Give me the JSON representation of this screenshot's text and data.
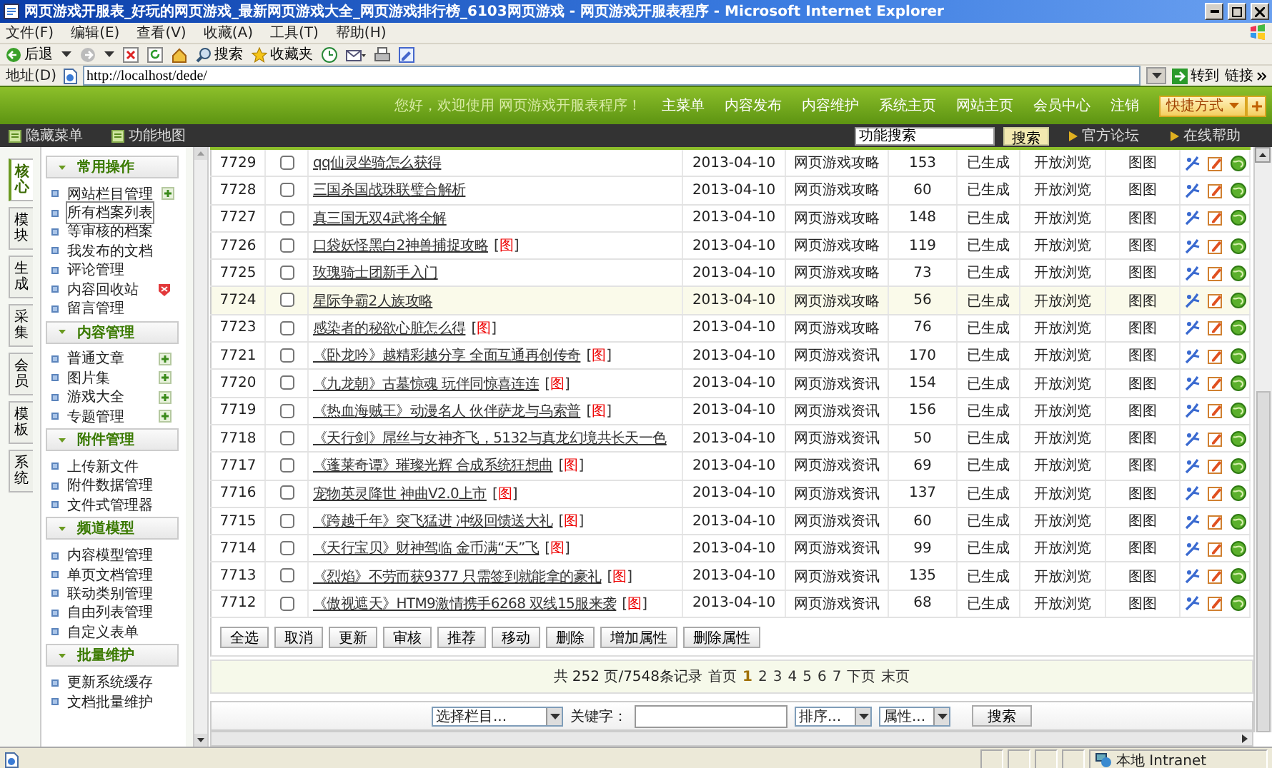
{
  "window": {
    "title": "网页游戏开服表_好玩的网页游戏_最新网页游戏大全_网页游戏排行榜_6103网页游戏 - 网页游戏开服表程序 - Microsoft Internet Explorer"
  },
  "menu_bar": [
    "文件(F)",
    "编辑(E)",
    "查看(V)",
    "收藏(A)",
    "工具(T)",
    "帮助(H)"
  ],
  "toolbar": {
    "back": "后退",
    "search": "搜索",
    "favorites": "收藏夹"
  },
  "address_bar": {
    "label": "地址(D)",
    "url": "http://localhost/dede/",
    "go": "转到",
    "links": "链接"
  },
  "header": {
    "welcome": "您好，欢迎使用 网页游戏开服表程序！",
    "nav": [
      "主菜单",
      "内容发布",
      "内容维护",
      "系统主页",
      "网站主页",
      "会员中心",
      "注销"
    ],
    "shortcut": "快捷方式"
  },
  "subbar": {
    "hide_menu": "隐藏菜单",
    "function_map": "功能地图",
    "search_value": "功能搜索",
    "search_button": "搜索",
    "links": [
      "官方论坛",
      "在线帮助"
    ]
  },
  "sidebar": {
    "tabs": [
      {
        "label": "核心",
        "selected": true
      },
      {
        "label": "模块",
        "selected": false
      },
      {
        "label": "生成",
        "selected": false
      },
      {
        "label": "采集",
        "selected": false
      },
      {
        "label": "会员",
        "selected": false
      },
      {
        "label": "模板",
        "selected": false
      },
      {
        "label": "系统",
        "selected": false
      }
    ],
    "groups": [
      {
        "title": "常用操作",
        "items": [
          {
            "label": "网站栏目管理",
            "kind": "add",
            "selected": false
          },
          {
            "label": "所有档案列表",
            "kind": "link",
            "selected": true
          },
          {
            "label": "等审核的档案",
            "kind": "link",
            "selected": false
          },
          {
            "label": "我发布的文档",
            "kind": "link",
            "selected": false
          },
          {
            "label": "评论管理",
            "kind": "link",
            "selected": false
          },
          {
            "label": "内容回收站",
            "kind": "delete",
            "selected": false
          },
          {
            "label": "留言管理",
            "kind": "link",
            "selected": false
          }
        ]
      },
      {
        "title": "内容管理",
        "items": [
          {
            "label": "普通文章",
            "kind": "add",
            "selected": false
          },
          {
            "label": "图片集",
            "kind": "add",
            "selected": false
          },
          {
            "label": "游戏大全",
            "kind": "add",
            "selected": false
          },
          {
            "label": "专题管理",
            "kind": "add",
            "selected": false
          }
        ]
      },
      {
        "title": "附件管理",
        "items": [
          {
            "label": "上传新文件",
            "kind": "link",
            "selected": false
          },
          {
            "label": "附件数据管理",
            "kind": "link",
            "selected": false
          },
          {
            "label": "文件式管理器",
            "kind": "link",
            "selected": false
          }
        ]
      },
      {
        "title": "频道模型",
        "items": [
          {
            "label": "内容模型管理",
            "kind": "link",
            "selected": false
          },
          {
            "label": "单页文档管理",
            "kind": "link",
            "selected": false
          },
          {
            "label": "联动类别管理",
            "kind": "link",
            "selected": false
          },
          {
            "label": "自由列表管理",
            "kind": "link",
            "selected": false
          },
          {
            "label": "自定义表单",
            "kind": "link",
            "selected": false
          }
        ]
      },
      {
        "title": "批量维护",
        "items": [
          {
            "label": "更新系统缓存",
            "kind": "link",
            "selected": false
          },
          {
            "label": "文档批量维护",
            "kind": "link",
            "selected": false
          }
        ]
      }
    ]
  },
  "table": {
    "rows": [
      {
        "id": "7729",
        "title": "qq仙灵坐骑怎么获得",
        "date": "2013-04-10",
        "category": "网页游戏攻略",
        "clicks": "153",
        "status": "已生成",
        "access": "开放浏览",
        "column_9": "图图",
        "checked": false,
        "highlighted": false
      },
      {
        "id": "7728",
        "title": "三国杀国战珠联璧合解析",
        "date": "2013-04-10",
        "category": "网页游戏攻略",
        "clicks": "60",
        "status": "已生成",
        "access": "开放浏览",
        "column_9": "图图",
        "checked": false,
        "highlighted": false
      },
      {
        "id": "7727",
        "title": "真三国无双4武将全解",
        "date": "2013-04-10",
        "category": "网页游戏攻略",
        "clicks": "148",
        "status": "已生成",
        "access": "开放浏览",
        "column_9": "图图",
        "checked": false,
        "highlighted": false
      },
      {
        "id": "7726",
        "title": "口袋妖怪黑白2神兽捕捉攻略",
        "tag": "[图]",
        "date": "2013-04-10",
        "category": "网页游戏攻略",
        "clicks": "119",
        "status": "已生成",
        "access": "开放浏览",
        "column_9": "图图",
        "checked": false,
        "highlighted": false
      },
      {
        "id": "7725",
        "title": "玫瑰骑士团新手入门",
        "date": "2013-04-10",
        "category": "网页游戏攻略",
        "clicks": "73",
        "status": "已生成",
        "access": "开放浏览",
        "column_9": "图图",
        "checked": false,
        "highlighted": false
      },
      {
        "id": "7724",
        "title": "星际争霸2人族攻略",
        "date": "2013-04-10",
        "category": "网页游戏攻略",
        "clicks": "56",
        "status": "已生成",
        "access": "开放浏览",
        "column_9": "图图",
        "checked": false,
        "highlighted": true
      },
      {
        "id": "7723",
        "title": "感染者的秘欲心脏怎么得",
        "tag": "[图]",
        "date": "2013-04-10",
        "category": "网页游戏攻略",
        "clicks": "76",
        "status": "已生成",
        "access": "开放浏览",
        "column_9": "图图",
        "checked": false,
        "highlighted": false
      },
      {
        "id": "7721",
        "title": "《卧龙吟》越精彩越分享 全面互通再创传奇",
        "tag": "[图]",
        "date": "2013-04-10",
        "category": "网页游戏资讯",
        "clicks": "170",
        "status": "已生成",
        "access": "开放浏览",
        "column_9": "图图",
        "checked": false,
        "highlighted": false
      },
      {
        "id": "7720",
        "title": "《九龙朝》古墓惊魂 玩伴同惊喜连连",
        "tag": "[图]",
        "date": "2013-04-10",
        "category": "网页游戏资讯",
        "clicks": "154",
        "status": "已生成",
        "access": "开放浏览",
        "column_9": "图图",
        "checked": false,
        "highlighted": false
      },
      {
        "id": "7719",
        "title": "《热血海贼王》动漫名人 伙伴萨龙与乌索普",
        "tag": "[图]",
        "date": "2013-04-10",
        "category": "网页游戏资讯",
        "clicks": "156",
        "status": "已生成",
        "access": "开放浏览",
        "column_9": "图图",
        "checked": false,
        "highlighted": false
      },
      {
        "id": "7718",
        "title": "《天行剑》屌丝与女神齐飞，5132与真龙幻境共长天一色",
        "date": "2013-04-10",
        "category": "网页游戏资讯",
        "clicks": "50",
        "status": "已生成",
        "access": "开放浏览",
        "column_9": "图图",
        "checked": false,
        "highlighted": false
      },
      {
        "id": "7717",
        "title": "《蓬莱奇谭》璀璨光辉 合成系统狂想曲",
        "tag": "[图]",
        "date": "2013-04-10",
        "category": "网页游戏资讯",
        "clicks": "69",
        "status": "已生成",
        "access": "开放浏览",
        "column_9": "图图",
        "checked": false,
        "highlighted": false
      },
      {
        "id": "7716",
        "title": "宠物英灵降世 神曲V2.0上市",
        "tag": "[图]",
        "date": "2013-04-10",
        "category": "网页游戏资讯",
        "clicks": "137",
        "status": "已生成",
        "access": "开放浏览",
        "column_9": "图图",
        "checked": false,
        "highlighted": false
      },
      {
        "id": "7715",
        "title": "《跨越千年》突飞猛进 冲级回馈送大礼",
        "tag": "[图]",
        "date": "2013-04-10",
        "category": "网页游戏资讯",
        "clicks": "60",
        "status": "已生成",
        "access": "开放浏览",
        "column_9": "图图",
        "checked": false,
        "highlighted": false
      },
      {
        "id": "7714",
        "title": "《天行宝贝》财神驾临 金币满“天”飞",
        "tag": "[图]",
        "date": "2013-04-10",
        "category": "网页游戏资讯",
        "clicks": "99",
        "status": "已生成",
        "access": "开放浏览",
        "column_9": "图图",
        "checked": false,
        "highlighted": false
      },
      {
        "id": "7713",
        "title": "《烈焰》不劳而获9377 只需签到就能拿的豪礼",
        "tag": "[图]",
        "date": "2013-04-10",
        "category": "网页游戏资讯",
        "clicks": "135",
        "status": "已生成",
        "access": "开放浏览",
        "column_9": "图图",
        "checked": false,
        "highlighted": false
      },
      {
        "id": "7712",
        "title": "《傲视遮天》HTM9激情携手6268 双线15服来袭",
        "tag": "[图]",
        "date": "2013-04-10",
        "category": "网页游戏资讯",
        "clicks": "68",
        "status": "已生成",
        "access": "开放浏览",
        "column_9": "图图",
        "checked": false,
        "highlighted": false
      }
    ]
  },
  "batch_buttons": [
    "全选",
    "取消",
    "更新",
    "审核",
    "推荐",
    "移动",
    "删除",
    "增加属性",
    "删除属性"
  ],
  "pagination": {
    "summary": "共 252 页/7548条记录",
    "first": "首页",
    "pages": [
      {
        "label": "1",
        "selected": true
      },
      {
        "label": "2",
        "selected": false
      },
      {
        "label": "3",
        "selected": false
      },
      {
        "label": "4",
        "selected": false
      },
      {
        "label": "5",
        "selected": false
      },
      {
        "label": "6",
        "selected": false
      },
      {
        "label": "7",
        "selected": false
      }
    ],
    "next": "下页",
    "last": "末页"
  },
  "search_form": {
    "category": "选择栏目...",
    "keyword_label": "关键字：",
    "sort": "排序...",
    "attribute": "属性...",
    "button": "搜索"
  },
  "status_bar": {
    "zone": "本地 Intranet"
  }
}
